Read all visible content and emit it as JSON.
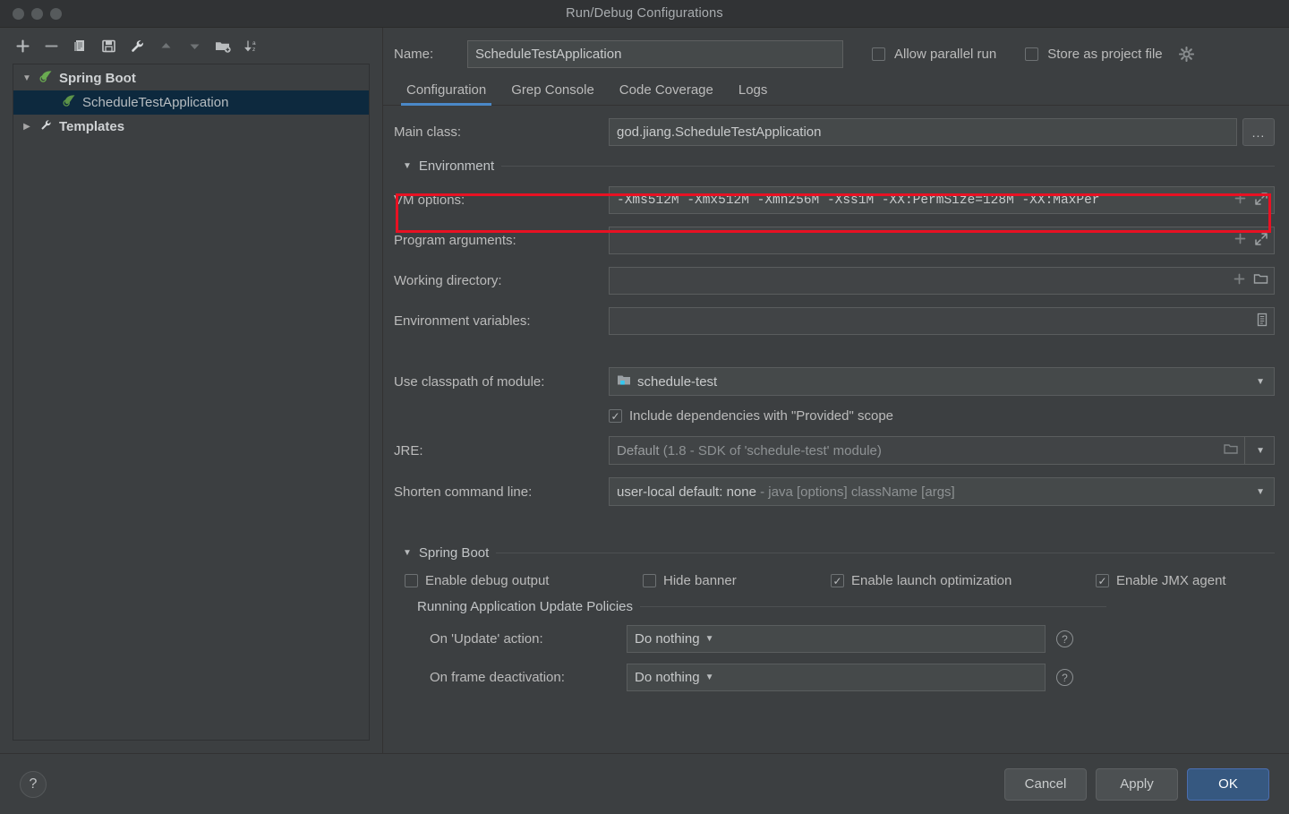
{
  "window": {
    "title": "Run/Debug Configurations"
  },
  "toolbar": {
    "buttons": [
      {
        "name": "add-button",
        "glyph": "+"
      },
      {
        "name": "remove-button",
        "glyph": "−"
      },
      {
        "name": "copy-configuration-button",
        "glyph": "copy-icon"
      },
      {
        "name": "save-configuration-button",
        "glyph": "save-icon"
      },
      {
        "name": "edit-templates-button",
        "glyph": "wrench-icon"
      },
      {
        "name": "move-up-button",
        "glyph": "arrow-up-icon"
      },
      {
        "name": "move-down-button",
        "glyph": "arrow-down-icon"
      },
      {
        "name": "new-folder-button",
        "glyph": "folder-add-icon"
      },
      {
        "name": "sort-button",
        "glyph": "sort-az-icon"
      }
    ]
  },
  "tree": {
    "nodes": [
      {
        "label": "Spring Boot",
        "icon": "spring-leaf-icon",
        "expanded": true,
        "selected": false,
        "level": 0
      },
      {
        "label": "ScheduleTestApplication",
        "icon": "spring-leaf-icon",
        "expanded": false,
        "selected": true,
        "level": 1
      },
      {
        "label": "Templates",
        "icon": "wrench-icon",
        "expanded": false,
        "selected": false,
        "level": 0
      }
    ]
  },
  "header": {
    "name_label": "Name:",
    "name_value": "ScheduleTestApplication",
    "allow_parallel_run_label": "Allow parallel run",
    "allow_parallel_run_checked": false,
    "store_as_project_file_label": "Store as project file",
    "store_as_project_file_checked": false,
    "gear_icon": "gear-icon"
  },
  "tabs": [
    {
      "label": "Configuration",
      "active": true
    },
    {
      "label": "Grep Console",
      "active": false
    },
    {
      "label": "Code Coverage",
      "active": false
    },
    {
      "label": "Logs",
      "active": false
    }
  ],
  "form": {
    "main_class_label": "Main class:",
    "main_class_value": "god.jiang.ScheduleTestApplication",
    "main_class_browse": "...",
    "environment_section": "Environment",
    "vm_options_label": "VM options:",
    "vm_options_value": "-Xms512M -Xmx512M -Xmn256M -Xss1M -XX:PermSize=128M -XX:MaxPer",
    "program_arguments_label": "Program arguments:",
    "program_arguments_value": "",
    "working_directory_label": "Working directory:",
    "working_directory_value": "",
    "environment_variables_label": "Environment variables:",
    "environment_variables_value": "",
    "use_classpath_label": "Use classpath of module:",
    "use_classpath_value": "schedule-test",
    "include_provided_label": "Include dependencies with \"Provided\" scope",
    "include_provided_checked": true,
    "jre_label": "JRE:",
    "jre_value": "Default",
    "jre_value_muted": "(1.8 - SDK of 'schedule-test' module)",
    "shorten_label": "Shorten command line:",
    "shorten_value": "user-local default: none",
    "shorten_value_muted": "- java [options] className [args]"
  },
  "spring_boot": {
    "section": "Spring Boot",
    "checkboxes": [
      {
        "label": "Enable debug output",
        "checked": false
      },
      {
        "label": "Hide banner",
        "checked": false
      },
      {
        "label": "Enable launch optimization",
        "checked": true
      },
      {
        "label": "Enable JMX agent",
        "checked": true
      }
    ],
    "policies_section": "Running Application Update Policies",
    "policies": [
      {
        "label": "On 'Update' action:",
        "value": "Do nothing"
      },
      {
        "label": "On frame deactivation:",
        "value": "Do nothing"
      }
    ]
  },
  "footer": {
    "help_label": "?",
    "cancel_label": "Cancel",
    "apply_label": "Apply",
    "ok_label": "OK"
  },
  "colors": {
    "background": "#3c3f41",
    "titlebar": "#313335",
    "field": "#45494a",
    "accent_blue": "#4a88c7",
    "primary_button": "#365880",
    "selection": "#0d293e",
    "highlight_red": "#e81123",
    "spring_green": "#6aab51"
  }
}
